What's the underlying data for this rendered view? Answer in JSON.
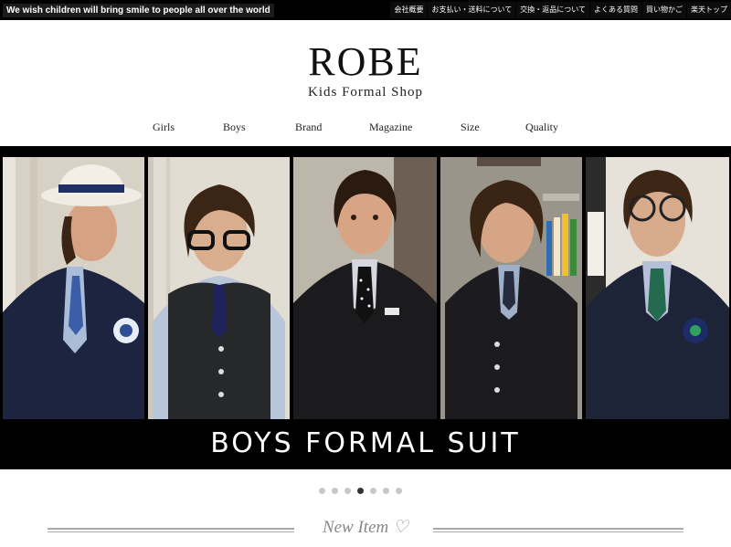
{
  "topbar": {
    "tagline": "We wish children will bring smile to people all over the world",
    "links": [
      "会社概要",
      "お支払い・送料について",
      "交換・返品について",
      "よくある質問",
      "買い物かご",
      "楽天トップ"
    ]
  },
  "logo": {
    "title": "ROBE",
    "subtitle": "Kids Formal Shop"
  },
  "nav": [
    "Girls",
    "Boys",
    "Brand",
    "Magazine",
    "Size",
    "Quality"
  ],
  "banner": {
    "caption": "BOYS FORMAL SUIT",
    "active_slide": 4,
    "slide_count": 7
  },
  "section": {
    "title": "New Item",
    "heart": "♡"
  },
  "colors": {
    "topbar": "#000000",
    "banner": "#000000",
    "active_dot": "#333333",
    "dot": "#c8c8c8"
  }
}
